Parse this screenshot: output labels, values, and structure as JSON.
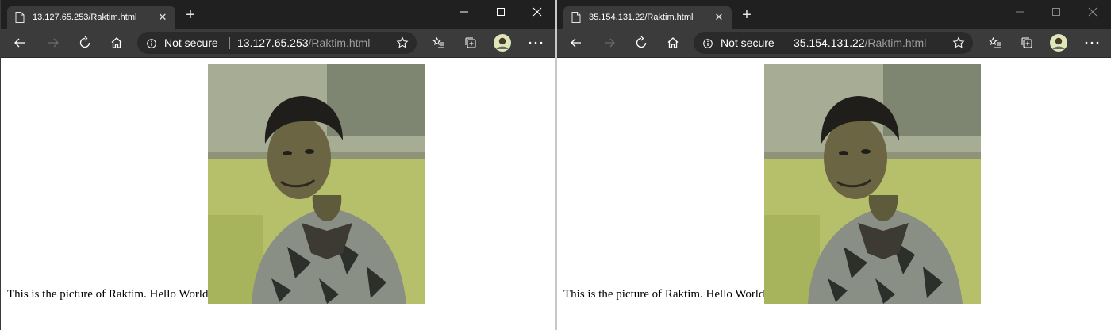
{
  "windows": [
    {
      "tab_title": "13.127.65.253/Raktim.html",
      "security_label": "Not secure",
      "url_host": "13.127.65.253",
      "url_path": "/Raktim.html",
      "page_text": "This is the picture of Raktim. Hello World."
    },
    {
      "tab_title": "35.154.131.22/Raktim.html",
      "security_label": "Not secure",
      "url_host": "35.154.131.22",
      "url_path": "/Raktim.html",
      "page_text": "This is the picture of Raktim. Hello World."
    }
  ],
  "icons": {
    "tab": "page-icon",
    "close": "close-icon",
    "new_tab": "plus-icon",
    "back": "back-arrow-icon",
    "forward": "forward-arrow-icon",
    "refresh": "refresh-icon",
    "home": "home-icon",
    "info": "info-icon",
    "favorite": "star-icon",
    "favorites_list": "favorites-icon",
    "collections": "collections-icon",
    "profile": "avatar",
    "menu": "more-icon"
  },
  "colors": {
    "titlebar": "#202020",
    "toolbar": "#3b3b3b",
    "active_tab": "#3b3b3b",
    "addressbar": "#2a2a2a",
    "url_path": "#9e9e9e",
    "page_bg": "#ffffff"
  }
}
